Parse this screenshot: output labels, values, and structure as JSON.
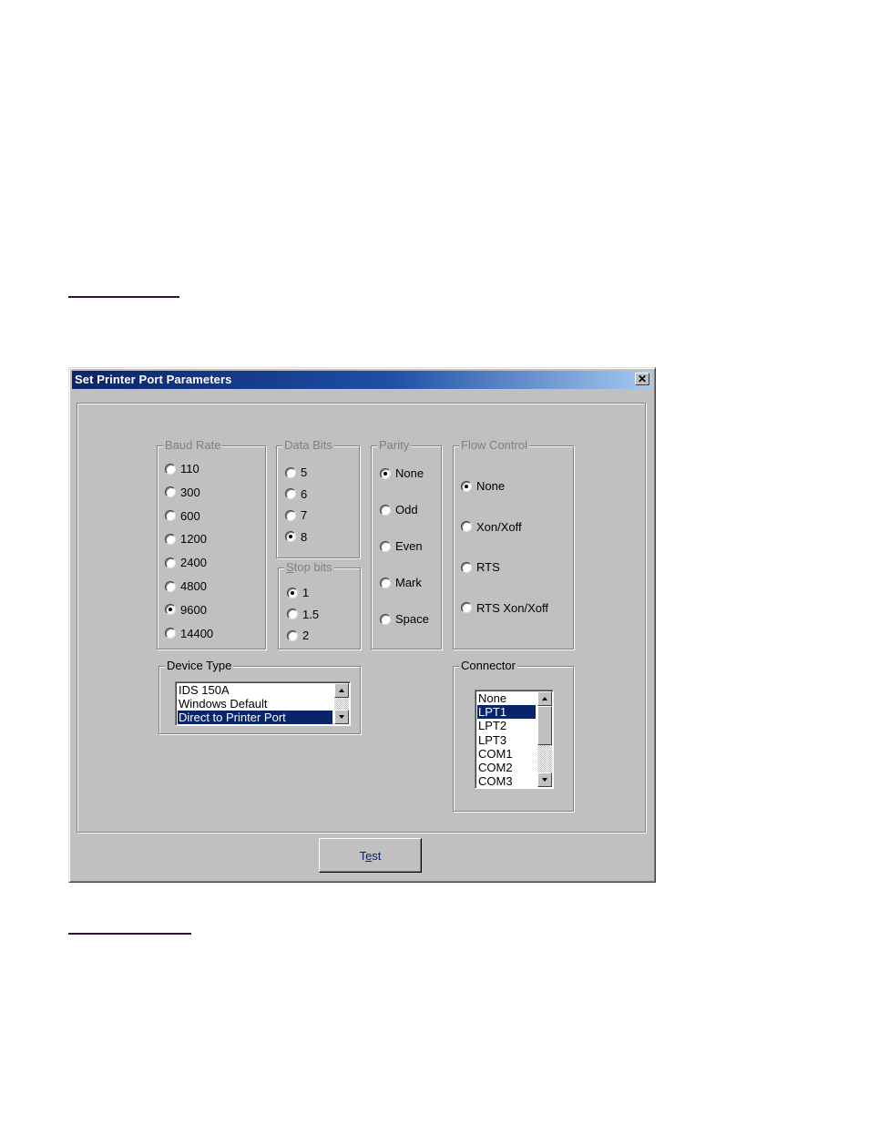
{
  "dialog": {
    "title": "Set Printer Port Parameters",
    "close_icon": "close-x-icon",
    "baud_rate": {
      "label": "Baud Rate",
      "options": [
        "110",
        "300",
        "600",
        "1200",
        "2400",
        "4800",
        "9600",
        "14400"
      ],
      "selected": "9600"
    },
    "data_bits": {
      "label": "Data Bits",
      "options": [
        "5",
        "6",
        "7",
        "8"
      ],
      "selected": "8"
    },
    "stop_bits": {
      "label": "Stop bits",
      "options": [
        "1",
        "1.5",
        "2"
      ],
      "selected": "1"
    },
    "parity": {
      "label": "Parity",
      "options": [
        "None",
        "Odd",
        "Even",
        "Mark",
        "Space"
      ],
      "selected": "None"
    },
    "flow_control": {
      "label": "Flow Control",
      "options": [
        "None",
        "Xon/Xoff",
        "RTS",
        "RTS Xon/Xoff"
      ],
      "selected": "None"
    },
    "device_type": {
      "label": "Device Type",
      "items": [
        "IDS 150A",
        "Windows Default",
        "Direct to Printer Port"
      ],
      "selected": "Direct to Printer Port"
    },
    "connector": {
      "label": "Connector",
      "items": [
        "None",
        "LPT1",
        "LPT2",
        "LPT3",
        "COM1",
        "COM2",
        "COM3"
      ],
      "selected": "LPT1"
    },
    "test_button": {
      "pre": "T",
      "accel": "e",
      "post": "st"
    }
  },
  "colors": {
    "link_rule": "#3c0a46",
    "titlebar_start": "#0a246a",
    "selection": "#0a246a",
    "face": "#c0c0c0"
  }
}
